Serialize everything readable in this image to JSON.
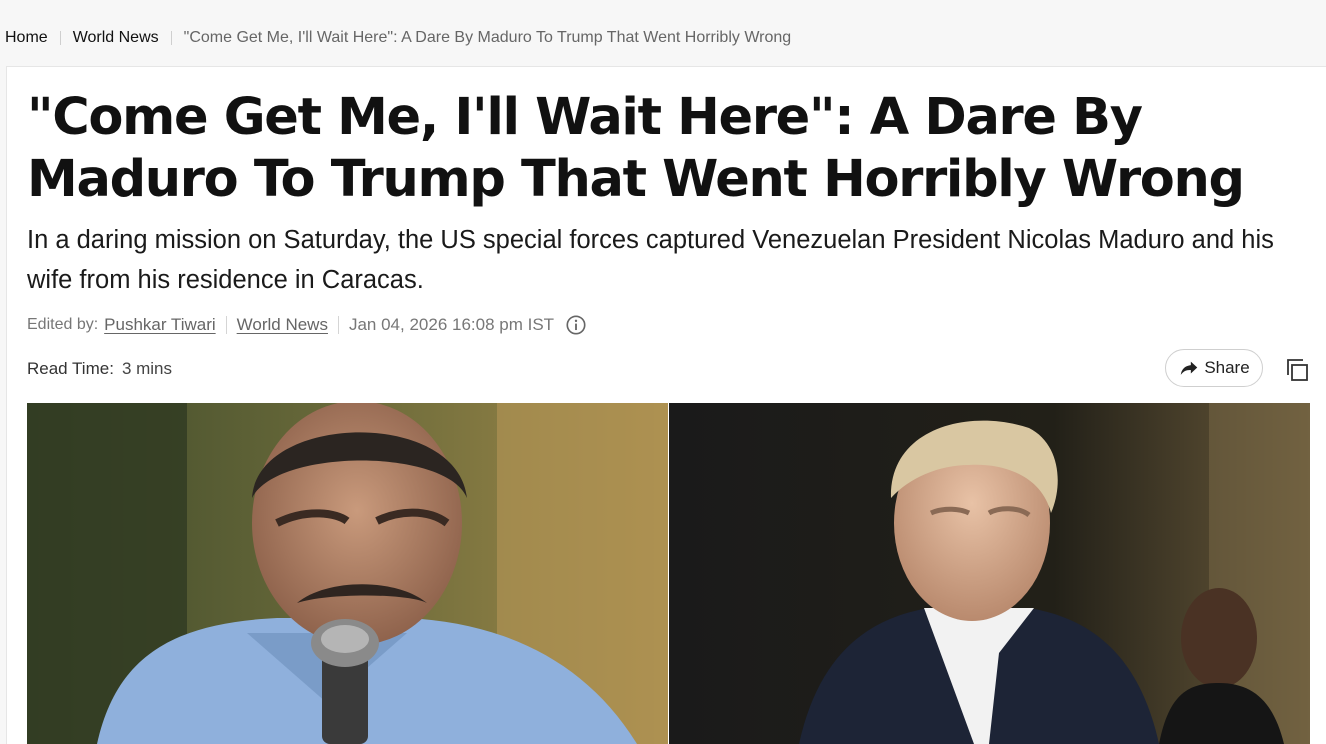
{
  "breadcrumb": {
    "home": "Home",
    "section": "World News",
    "current": "\"Come Get Me, I'll Wait Here\": A Dare By Maduro To Trump That Went Horribly Wrong"
  },
  "article": {
    "headline": "\"Come Get Me, I'll Wait Here\": A Dare By Maduro To Trump That Went Horribly Wrong",
    "summary": "In a daring mission on Saturday, the US special forces captured Venezuelan President Nicolas Maduro and his wife from his residence in Caracas.",
    "meta": {
      "edited_by_label": "Edited by:",
      "editor": "Pushkar Tiwari",
      "category": "World News",
      "date": "Jan 04, 2026 16:08 pm IST"
    },
    "read_time": {
      "label": "Read Time:",
      "value": "3 mins"
    },
    "share_label": "Share",
    "icons": {
      "info": "info-icon",
      "share": "share-arrow-icon",
      "copy": "copy-icon"
    }
  },
  "colors": {
    "background": "#f7f7f7",
    "card": "#ffffff",
    "text": "#111111",
    "muted": "#666666"
  }
}
